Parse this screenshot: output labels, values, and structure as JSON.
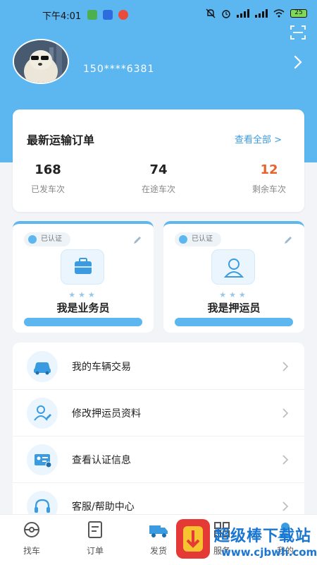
{
  "status_bar": {
    "time": "下午4:01",
    "battery": "25"
  },
  "profile": {
    "phone": "150****6381"
  },
  "orders": {
    "title": "最新运输订单",
    "view_all": "查看全部 >",
    "stats": [
      {
        "value": "168",
        "label": "已发车次",
        "color": "#222222"
      },
      {
        "value": "74",
        "label": "在途车次",
        "color": "#222222"
      },
      {
        "value": "12",
        "label": "剩余车次",
        "color": "#e8622c"
      }
    ]
  },
  "roles": [
    {
      "badge": "已认证",
      "stars": "★★★",
      "name": "我是业务员",
      "icon": "briefcase-icon"
    },
    {
      "badge": "已认证",
      "stars": "★★★",
      "name": "我是押运员",
      "icon": "person-icon"
    }
  ],
  "menu": [
    {
      "label": "我的车辆交易",
      "icon": "car-icon"
    },
    {
      "label": "修改押运员资料",
      "icon": "user-edit-icon"
    },
    {
      "label": "查看认证信息",
      "icon": "id-card-icon"
    },
    {
      "label": "客服/帮助中心",
      "icon": "headset-icon"
    }
  ],
  "tabs": [
    {
      "label": "找车",
      "icon": "steering-wheel-icon"
    },
    {
      "label": "订单",
      "icon": "order-list-icon"
    },
    {
      "label": "发货",
      "icon": "truck-icon"
    },
    {
      "label": "服务",
      "icon": "grid-icon"
    },
    {
      "label": "我的",
      "icon": "profile-icon"
    }
  ],
  "watermark": {
    "title": "超级棒下载站",
    "url": "www.cjbwh.com"
  },
  "colors": {
    "header": "#5cb6f0",
    "accent": "#3a9be0",
    "highlight": "#e8622c"
  }
}
